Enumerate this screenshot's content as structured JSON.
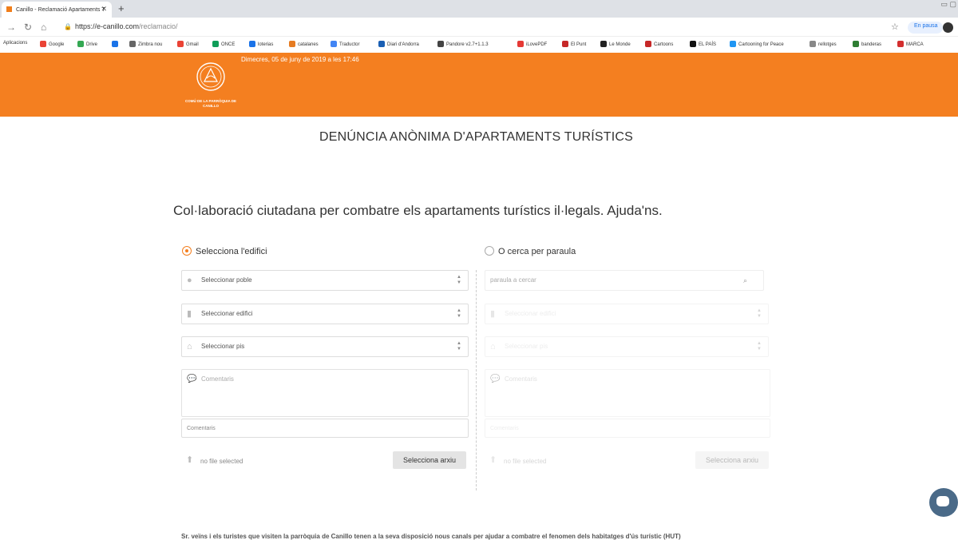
{
  "browser": {
    "tab_title": "Canillo - Reclamació Apartaments T",
    "tab_close": "✕",
    "new_tab": "+",
    "window_controls": "▭ ▢",
    "url_host": "https://e-canillo.com",
    "url_path": "/reclamacio/",
    "pause_label": "En pausa",
    "bookmarks": [
      {
        "label": "Aplicacions",
        "color": "#4285f4"
      },
      {
        "label": "Google",
        "color": "#ea4335"
      },
      {
        "label": "Drive",
        "color": "#34a853"
      },
      {
        "label": "",
        "color": "#1a73e8"
      },
      {
        "label": "Zimbra nou",
        "color": "#666666"
      },
      {
        "label": "Gmail",
        "color": "#ea4335"
      },
      {
        "label": "ONCE",
        "color": "#0f9d58"
      },
      {
        "label": "loterias",
        "color": "#1a73e8"
      },
      {
        "label": "catalanes",
        "color": "#e67c22"
      },
      {
        "label": "Traductor",
        "color": "#4285f4"
      },
      {
        "label": "Diari d'Andorra",
        "color": "#1a5fb4"
      },
      {
        "label": "Pandore v2.7+1.1.3",
        "color": "#444444"
      },
      {
        "label": "iLovePDF",
        "color": "#e53935"
      },
      {
        "label": "El Punt",
        "color": "#c62828"
      },
      {
        "label": "Le Monde",
        "color": "#222222"
      },
      {
        "label": "Cartoons",
        "color": "#c62828"
      },
      {
        "label": "EL PAÍS",
        "color": "#111111"
      },
      {
        "label": "Cartooning for Peace",
        "color": "#2196f3"
      },
      {
        "label": "rellotges",
        "color": "#888888"
      },
      {
        "label": "banderas",
        "color": "#2e7d32"
      },
      {
        "label": "MARCA",
        "color": "#d32f2f"
      }
    ]
  },
  "header": {
    "date": "Dimecres, 05 de juny de 2019 a les 17:46",
    "logo_text": "COMÚ DE LA PARRÒQUIA DE CANILLO"
  },
  "main": {
    "title": "DENÚNCIA ANÒNIMA D'APARTAMENTS TURÍSTICS",
    "subtitle": "Col·laboració ciutadana per combatre els apartaments turístics il·legals. Ajuda'ns."
  },
  "left": {
    "radio_label": "Selecciona l'edifici",
    "poble": "Seleccionar poble",
    "edifici": "Seleccionar edifici",
    "pis": "Seleccionar pis",
    "comentaris": "Comentaris",
    "comentaris_small": "Comentaris",
    "no_file": "no file selected",
    "file_button": "Selecciona arxiu"
  },
  "right": {
    "radio_label": "O cerca per paraula",
    "search_placeholder": "paraula a cercar",
    "edifici": "Seleccionar edifici",
    "pis": "Seleccionar pis",
    "comentaris": "Comentaris",
    "comentaris_small": "Comentaris",
    "no_file": "no file selected",
    "file_button": "Selecciona arxiu"
  },
  "footer": {
    "text": "Sr. veïns i els turistes que visiten la parròquia de Canillo tenen a la seva disposició nous canals per ajudar a combatre el fenomen dels habitatges d'ús turístic (HUT)"
  }
}
